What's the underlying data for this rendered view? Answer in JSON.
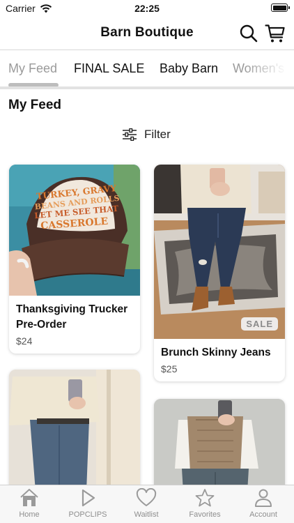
{
  "status_bar": {
    "carrier": "Carrier",
    "time": "22:25"
  },
  "nav": {
    "title": "Barn Boutique",
    "icons": [
      "search-icon",
      "cart-icon"
    ]
  },
  "tabs": [
    {
      "label": "My Feed",
      "selected": true
    },
    {
      "label": "FINAL SALE",
      "selected": false
    },
    {
      "label": "Baby Barn",
      "selected": false
    },
    {
      "label": "Women's",
      "selected": false
    }
  ],
  "feed": {
    "heading": "My Feed",
    "filter_label": "Filter"
  },
  "products": [
    {
      "title": "Thanksgiving Trucker Pre-Order",
      "price": "$24",
      "sale": false,
      "hat_text": "TURKEY, GRAVY BEANS AND ROLLS LET ME SEE THAT CASSEROLE"
    },
    {
      "title": "Brunch Skinny Jeans",
      "price": "$25",
      "sale": true,
      "sale_label": "SALE"
    }
  ],
  "tab_bar": [
    {
      "label": "Home",
      "icon": "home-icon"
    },
    {
      "label": "POPCLIPS",
      "icon": "play-icon"
    },
    {
      "label": "Waitlist",
      "icon": "heart-icon"
    },
    {
      "label": "Favorites",
      "icon": "star-icon"
    },
    {
      "label": "Account",
      "icon": "person-icon"
    }
  ],
  "colors": {
    "accent_gray": "#bdbdbd",
    "tab_label": "#8e8e8e",
    "hat_brown": "#5a3a2e",
    "hat_text_orange": "#d9782e"
  }
}
